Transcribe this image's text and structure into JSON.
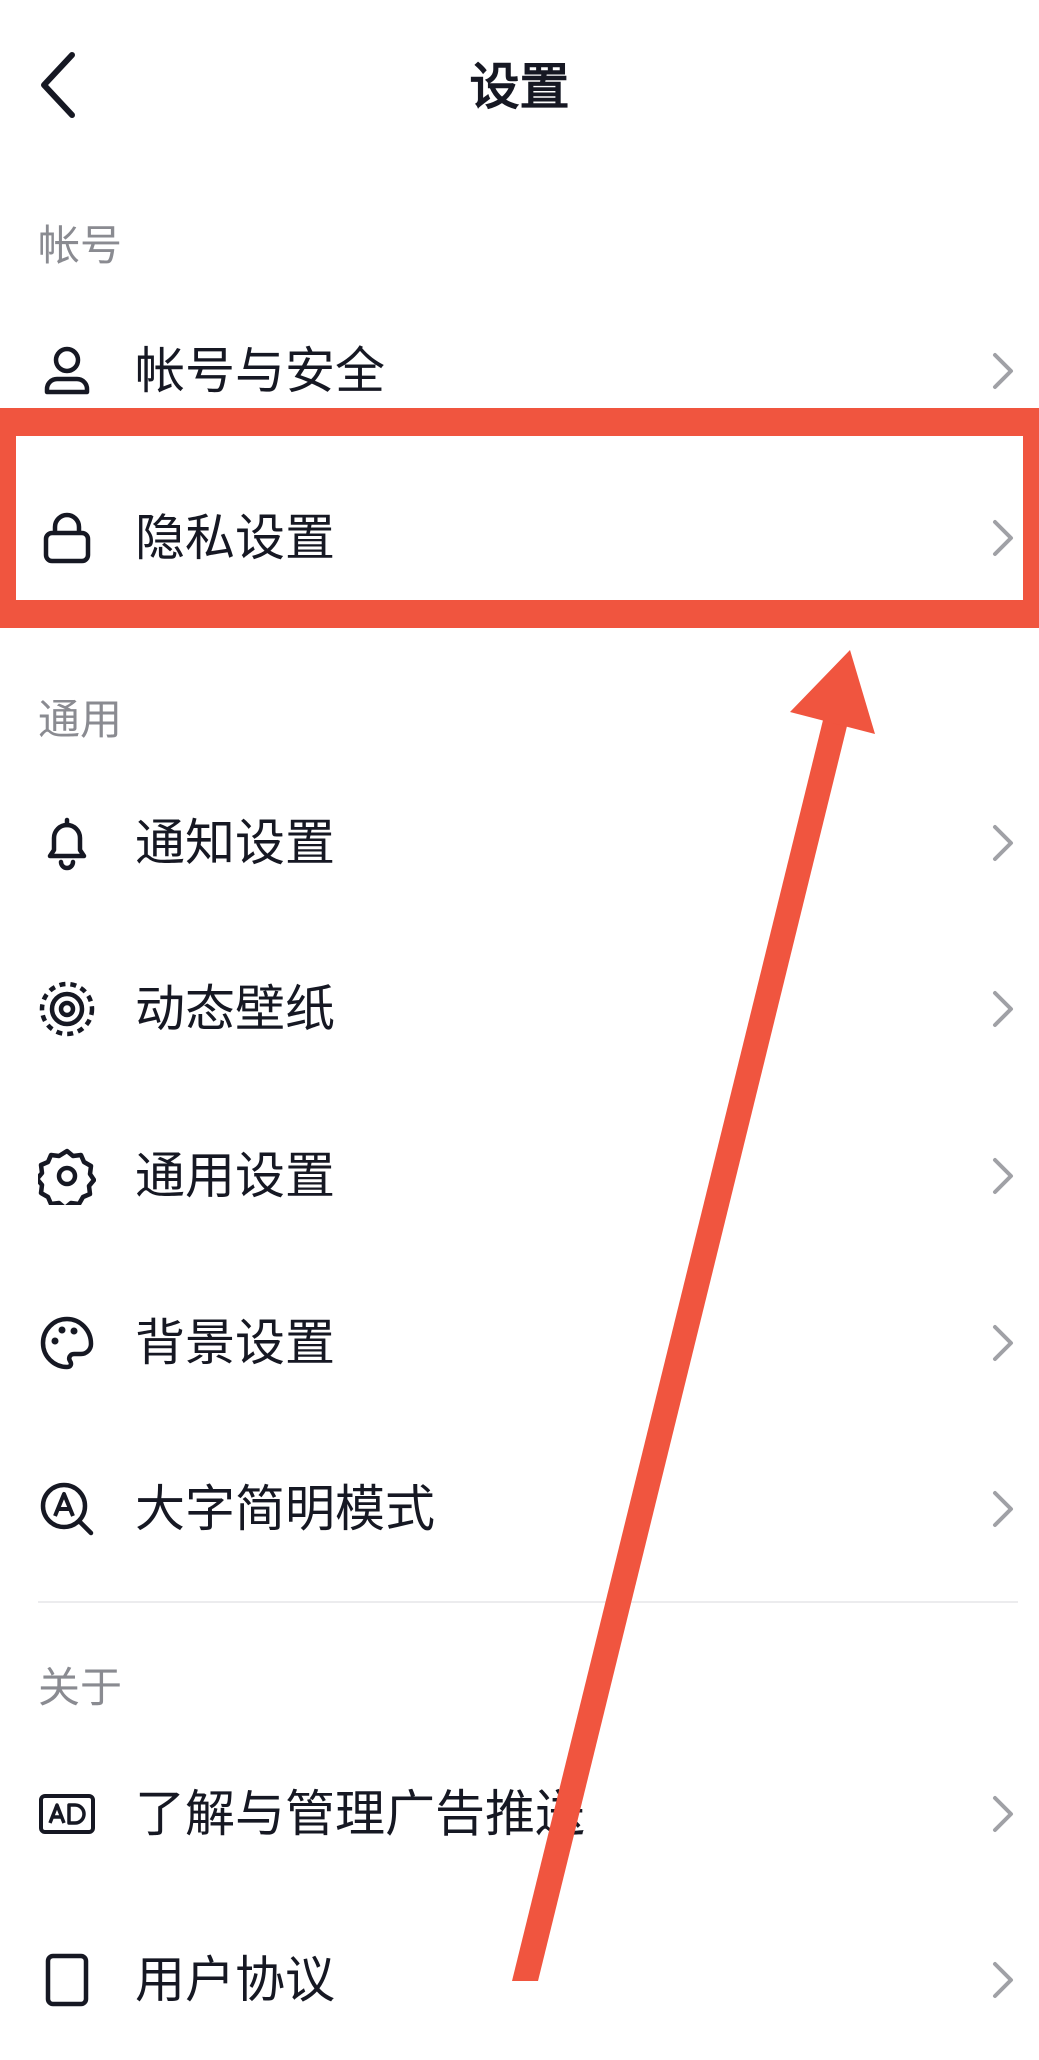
{
  "header": {
    "title": "设置"
  },
  "sections": {
    "account": "帐号",
    "general": "通用",
    "about": "关于"
  },
  "items": {
    "account_security": "帐号与安全",
    "privacy": "隐私设置",
    "notifications": "通知设置",
    "live_wallpaper": "动态壁纸",
    "general_settings": "通用设置",
    "background": "背景设置",
    "large_text_mode": "大字简明模式",
    "ad_management": "了解与管理广告推送",
    "user_agreement": "用户协议"
  },
  "icons": {
    "back": "chevron-left-icon",
    "account_security": "user-icon",
    "privacy": "lock-icon",
    "notifications": "bell-icon",
    "live_wallpaper": "target-icon",
    "general_settings": "gear-icon",
    "background": "palette-icon",
    "large_text_mode": "font-search-icon",
    "ad_management": "ad-icon",
    "user_agreement": "document-icon",
    "row_chevron": "chevron-right-icon"
  },
  "colors": {
    "accent_annotation": "#f0553f",
    "text_primary": "#161823",
    "text_secondary": "#8a8b91"
  }
}
